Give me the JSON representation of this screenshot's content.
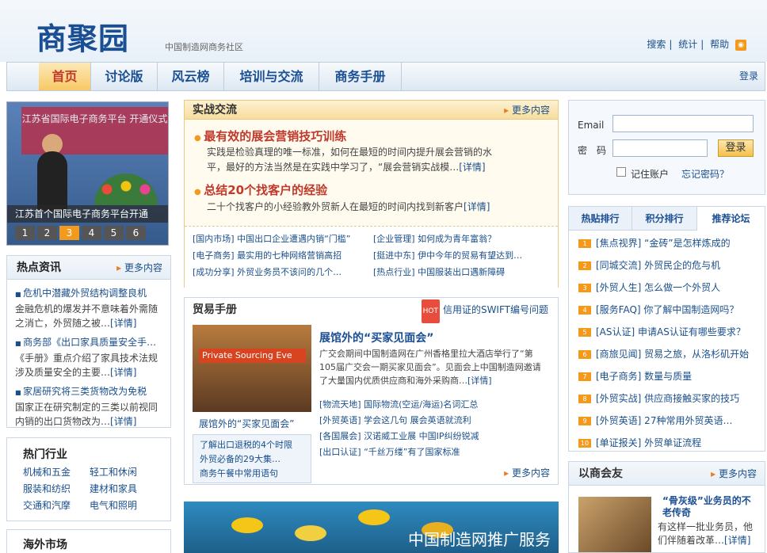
{
  "header": {
    "logo": "商聚园",
    "slogan": "中国制造网商务社区",
    "links": [
      "搜索",
      "统计",
      "帮助"
    ]
  },
  "nav": {
    "items": [
      "首页",
      "讨论版",
      "风云榜",
      "培训与交流",
      "商务手册"
    ],
    "login": "登录"
  },
  "slide": {
    "banner": "江苏省国际电子商务平台 开通仪式",
    "caption": "江苏首个国际电子商务平台开通",
    "pages": [
      "1",
      "2",
      "3",
      "4",
      "5",
      "6"
    ],
    "active": 2
  },
  "hotnews": {
    "title": "热点资讯",
    "more": "更多内容",
    "items": [
      {
        "title": "危机中潜藏外贸结构调整良机",
        "desc": "金融危机的爆发并不意味着外需随之消亡，外贸随之被…",
        "detail": "[详情]"
      },
      {
        "title": "商务部《出口家具质量安全手…",
        "desc": "《手册》重点介绍了家具技术法规涉及质量安全的主要…",
        "detail": "[详情]"
      },
      {
        "title": "家居研究将三类货物改为免税",
        "desc": "国家正在研究制定的三类以前视同内销的出口货物改为…",
        "detail": "[详情]"
      }
    ]
  },
  "industry": {
    "title": "热门行业",
    "items": [
      "机械和五金",
      "轻工和休闲",
      "服装和纺织",
      "建材和家具",
      "交通和汽摩",
      "电气和照明"
    ]
  },
  "market": {
    "title": "海外市场"
  },
  "practice": {
    "title": "实战交流",
    "more": "更多内容",
    "t1": "最有效的展会营销技巧训练",
    "d1a": "实践是检验真理的唯一标准，如何在最短的时间内提升展会营销的水",
    "d1b": "平，最好的方法当然是在实践中学习了，“展会营销实战模…",
    "detail1": "[详情]",
    "t2": "总结20个找客户的经验",
    "d2": "二十个找客户的小经验教外贸新人在最短的时间内找到新客户",
    "detail2": "[详情]",
    "links": [
      "[国内市场]  中国出口企业遭遇内销“门槛”",
      "[企业管理]  如何成为青年富翁？",
      "[电子商务]  最实用的七种网络营销高招",
      "[挺进中东]  伊中今年的贸易有望达到…",
      "[成功分享]  外贸业务员不该问的几个…",
      "[热点行业]  中国服装出口遇新障碍"
    ]
  },
  "handbook": {
    "title": "贸易手册",
    "hot": "HOT",
    "hotlink": "信用证的SWIFT编号问题",
    "imgbar": "Private Sourcing Eve",
    "imgcap": "展馆外的“买家见面会”",
    "headline": "展馆外的“买家见面会”",
    "body": "广交会期间中国制造网在广州香格里拉大酒店举行了“第105届广交会一期买家见面会”。见面会上中国制造网邀请了大量国内优质供应商和海外采购商…",
    "detail": "[详情]",
    "links": [
      "[物流天地]  国际物流(空运/海运)名词汇总",
      "[外贸英语]  学会这几句 展会英语就流利",
      "[各国展会]  汉诺威工业展 中国IP纠纷锐减",
      "[出口认证]  “千丝万缕”有了国家标准"
    ],
    "side": [
      "了解出口退税的4个时限",
      "外贸必备的29大集…",
      "商务午餐中常用语句"
    ],
    "more": "更多内容"
  },
  "adtext": "中国制造网推广服务",
  "login": {
    "email": "Email",
    "pwd": "密　码",
    "btn": "登录",
    "remember": "记住账户",
    "forgot": "忘记密码？"
  },
  "tabs": {
    "items": [
      "热贴排行",
      "积分排行",
      "推荐论坛"
    ],
    "active": 2,
    "list": [
      "[焦点视界] “金砖”是怎样炼成的",
      "[同城交流] 外贸民企的危与机",
      "[外贸人生] 怎么做一个外贸人",
      "[服务FAQ] 你了解中国制造网吗？",
      "[AS认证] 申请AS认证有哪些要求？",
      "[商旅见闻] 贸易之旅，从洛杉矶开始",
      "[电子商务] 数量与质量",
      "[外贸实战] 供应商接触买家的技巧",
      "[外贸英语] 27种常用外贸英语…",
      "[单证报关] 外贸单证流程"
    ]
  },
  "friends": {
    "title": "以商会友",
    "more": "更多内容",
    "headline": "“骨灰级”业务员的不老传奇",
    "body": "有这样一批业务员，他们伴随着改革…",
    "detail": "[详情]"
  }
}
